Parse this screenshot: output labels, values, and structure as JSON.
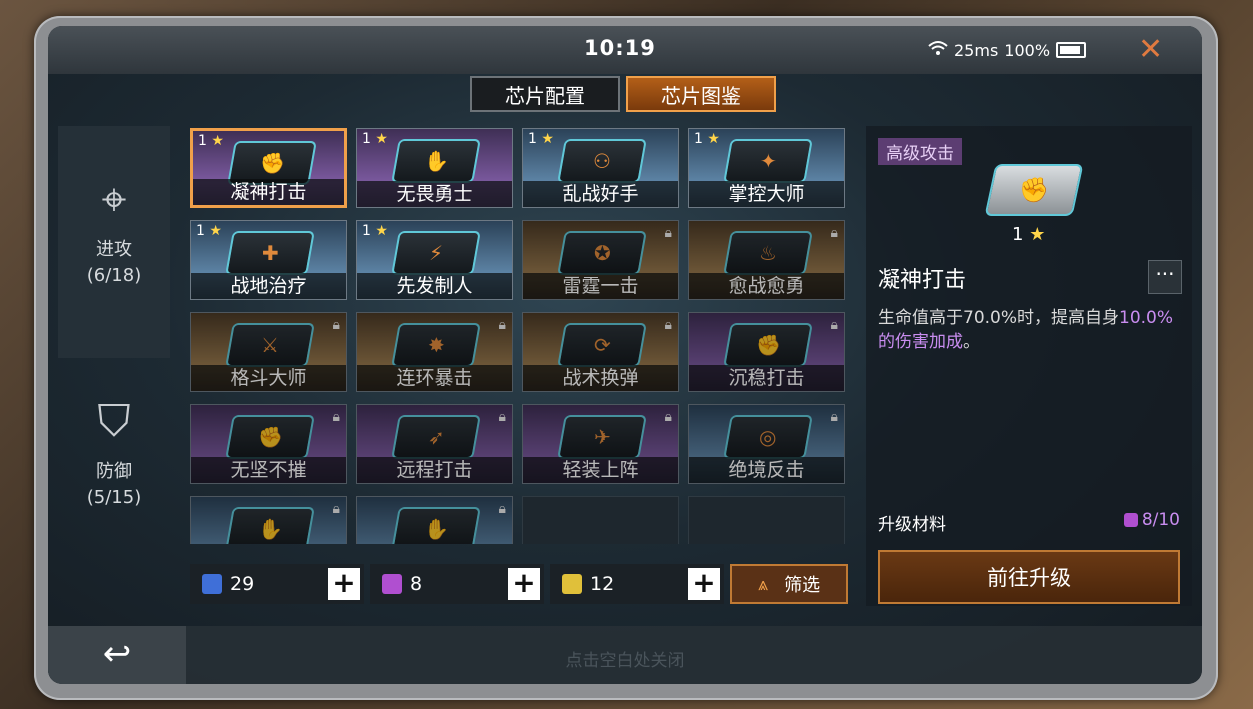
{
  "status_bar": {
    "time": "10:19",
    "ping": "25ms",
    "battery": "100%"
  },
  "tabs": [
    {
      "label": "芯片配置",
      "active": false
    },
    {
      "label": "芯片图鉴",
      "active": true
    }
  ],
  "sidebar": [
    {
      "icon": "crosshair-icon",
      "label": "进攻",
      "count": "(6/18)"
    },
    {
      "icon": "shield-icon",
      "label": "防御",
      "count": "(5/15)"
    }
  ],
  "chips": [
    {
      "name": "凝神打击",
      "level": "1",
      "star": "★",
      "color": "p",
      "locked": false,
      "selected": true,
      "icon": "✊"
    },
    {
      "name": "无畏勇士",
      "level": "1",
      "star": "★",
      "color": "p",
      "locked": false,
      "selected": false,
      "icon": "✋"
    },
    {
      "name": "乱战好手",
      "level": "1",
      "star": "★",
      "color": "b",
      "locked": false,
      "selected": false,
      "icon": "⚇"
    },
    {
      "name": "掌控大师",
      "level": "1",
      "star": "★",
      "color": "b",
      "locked": false,
      "selected": false,
      "icon": "✦"
    },
    {
      "name": "战地治疗",
      "level": "1",
      "star": "★",
      "color": "b",
      "locked": false,
      "selected": false,
      "icon": "✚"
    },
    {
      "name": "先发制人",
      "level": "1",
      "star": "★",
      "color": "b",
      "locked": false,
      "selected": false,
      "icon": "⚡"
    },
    {
      "name": "雷霆一击",
      "level": "",
      "star": "",
      "color": "o",
      "locked": true,
      "selected": false,
      "icon": "✪"
    },
    {
      "name": "愈战愈勇",
      "level": "",
      "star": "",
      "color": "o",
      "locked": true,
      "selected": false,
      "icon": "♨"
    },
    {
      "name": "格斗大师",
      "level": "",
      "star": "",
      "color": "o",
      "locked": true,
      "selected": false,
      "icon": "⚔"
    },
    {
      "name": "连环暴击",
      "level": "",
      "star": "",
      "color": "o",
      "locked": true,
      "selected": false,
      "icon": "✸"
    },
    {
      "name": "战术换弹",
      "level": "",
      "star": "",
      "color": "o",
      "locked": true,
      "selected": false,
      "icon": "⟳"
    },
    {
      "name": "沉稳打击",
      "level": "",
      "star": "",
      "color": "p",
      "locked": true,
      "selected": false,
      "icon": "✊"
    },
    {
      "name": "无坚不摧",
      "level": "",
      "star": "",
      "color": "p",
      "locked": true,
      "selected": false,
      "icon": "✊"
    },
    {
      "name": "远程打击",
      "level": "",
      "star": "",
      "color": "p",
      "locked": true,
      "selected": false,
      "icon": "➶"
    },
    {
      "name": "轻装上阵",
      "level": "",
      "star": "",
      "color": "p",
      "locked": true,
      "selected": false,
      "icon": "✈"
    },
    {
      "name": "绝境反击",
      "level": "",
      "star": "",
      "color": "b",
      "locked": true,
      "selected": false,
      "icon": "◎"
    },
    {
      "name": "",
      "level": "",
      "star": "",
      "color": "b",
      "locked": true,
      "selected": false,
      "icon": "✋"
    },
    {
      "name": "",
      "level": "",
      "star": "",
      "color": "b",
      "locked": true,
      "selected": false,
      "icon": "✋"
    },
    {
      "name": "",
      "level": "",
      "star": "",
      "color": "e",
      "locked": false,
      "selected": false,
      "icon": ""
    },
    {
      "name": "",
      "level": "",
      "star": "",
      "color": "e",
      "locked": false,
      "selected": false,
      "icon": ""
    }
  ],
  "resources": [
    {
      "value": "29",
      "color": "#3f6fd8",
      "icon": "blue-chip-icon"
    },
    {
      "value": "8",
      "color": "#b04fd0",
      "icon": "purple-chip-icon"
    },
    {
      "value": "12",
      "color": "#e0c03a",
      "icon": "gold-chip-icon"
    }
  ],
  "filter_label": "筛选",
  "detail": {
    "tag": "高级攻击",
    "stars": "1",
    "star": "★",
    "name": "凝神打击",
    "more": "···",
    "desc_part1": "生命值高于70.0%时，提高自身",
    "desc_highlight": "10.0%的伤害加成",
    "desc_part2": "。",
    "materials_label": "升级材料",
    "materials_value": "8/10",
    "upgrade_button": "前往升级"
  },
  "bottom_hint": "点击空白处关闭",
  "colors": {
    "accent_orange": "#f0a04a",
    "purple_text": "#c98df0"
  }
}
